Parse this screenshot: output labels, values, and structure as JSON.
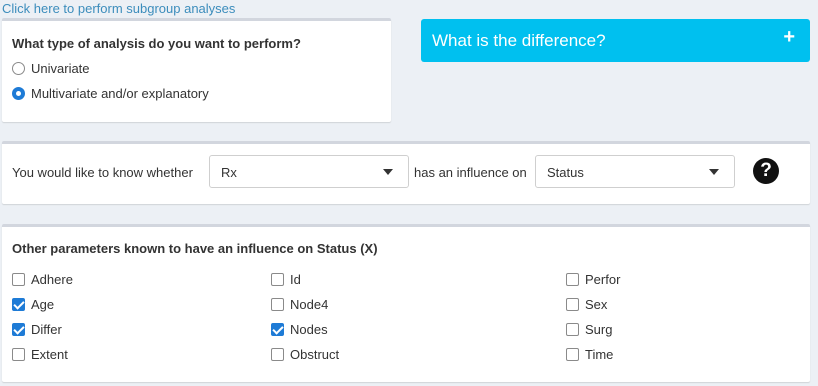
{
  "subgroup_link": "Click here to perform subgroup analyses",
  "analysis": {
    "title": "What type of analysis do you want to perform?",
    "options": [
      {
        "label": "Univariate",
        "checked": false
      },
      {
        "label": "Multivariate and/or explanatory",
        "checked": true
      }
    ]
  },
  "difference_panel": {
    "title": "What is the difference?",
    "toggle": "+"
  },
  "question": {
    "prefix": "You would like to know whether",
    "exposure_value": "Rx",
    "middle": "has an influence on",
    "outcome_value": "Status",
    "help_icon": "?"
  },
  "parameters": {
    "title": "Other parameters known to have an influence on Status (X)",
    "columns": [
      [
        {
          "label": "Adhere",
          "checked": false
        },
        {
          "label": "Age",
          "checked": true
        },
        {
          "label": "Differ",
          "checked": true
        },
        {
          "label": "Extent",
          "checked": false
        }
      ],
      [
        {
          "label": "Id",
          "checked": false
        },
        {
          "label": "Node4",
          "checked": false
        },
        {
          "label": "Nodes",
          "checked": true
        },
        {
          "label": "Obstruct",
          "checked": false
        }
      ],
      [
        {
          "label": "Perfor",
          "checked": false
        },
        {
          "label": "Sex",
          "checked": false
        },
        {
          "label": "Surg",
          "checked": false
        },
        {
          "label": "Time",
          "checked": false
        }
      ]
    ]
  },
  "colors": {
    "accent": "#00c0ef",
    "link": "#3c8dbc",
    "checked": "#1e7bd6",
    "background": "#ecf0f5"
  }
}
